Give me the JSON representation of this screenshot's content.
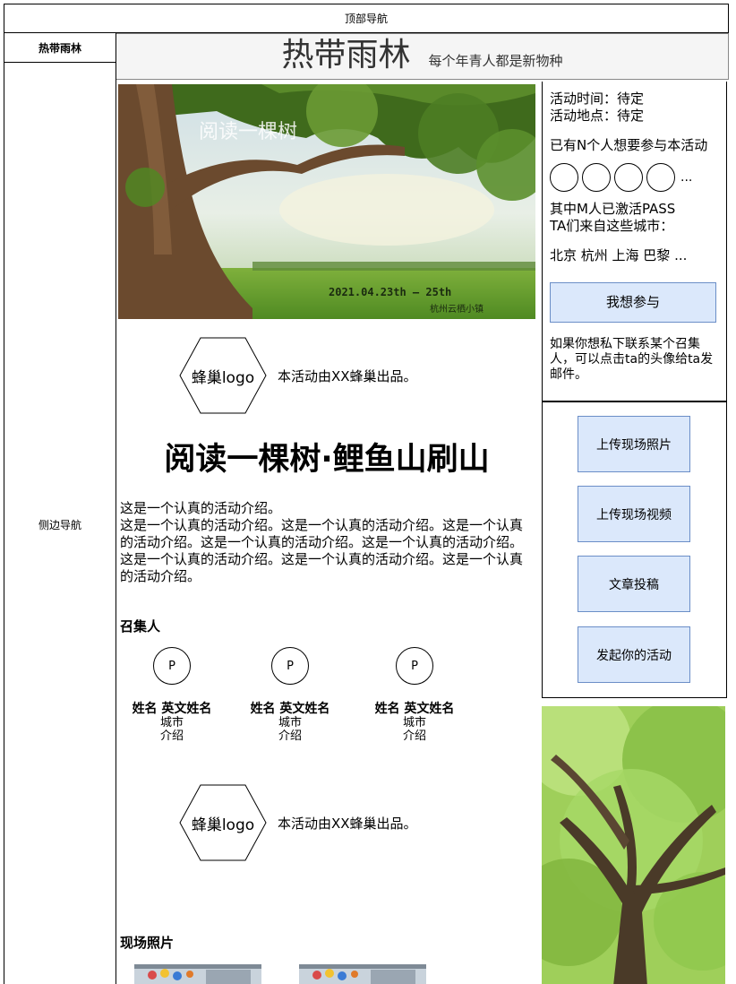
{
  "top_nav": {
    "label": "顶部导航"
  },
  "side_nav": {
    "brand": "热带雨林",
    "label": "侧边导航"
  },
  "header": {
    "title": "热带雨林",
    "subtitle": "每个年青人都是新物种"
  },
  "poster": {
    "title": "阅读一棵树",
    "dates": "2021.04.23th — 25th",
    "place": "杭州云栖小镇"
  },
  "event_info": {
    "time": "活动时间：待定",
    "location": "活动地点：待定",
    "interested": "已有N个人想要参与本活动",
    "more_avatars": "...",
    "pass_count": "其中M人已激活PASS",
    "cities_label": "TA们来自这些城市：",
    "cities": "北京 杭州 上海 巴黎 ...",
    "join_button": "我想参与",
    "private_note": "如果你想私下联系某个召集人，可以点击ta的头像给ta发邮件。"
  },
  "actions": {
    "upload_photos": "上传现场照片",
    "upload_video": "上传现场视频",
    "submit_article": "文章投稿",
    "start_event": "发起你的活动"
  },
  "organizer_block": {
    "logo": "蜂巢logo",
    "text": "本活动由XX蜂巢出品。"
  },
  "event": {
    "title": "阅读一棵树·鲤鱼山刷山",
    "intro_line1": "这是一个认真的活动介绍。",
    "intro_body": "这是一个认真的活动介绍。这是一个认真的活动介绍。这是一个认真的活动介绍。这是一个认真的活动介绍。这是一个认真的活动介绍。这是一个认真的活动介绍。这是一个认真的活动介绍。这是一个认真的活动介绍。"
  },
  "organizers": {
    "title": "召集人",
    "people": [
      {
        "avatar": "P",
        "name": "姓名 英文姓名",
        "city": "城市",
        "bio": "介绍"
      },
      {
        "avatar": "P",
        "name": "姓名 英文姓名",
        "city": "城市",
        "bio": "介绍"
      },
      {
        "avatar": "P",
        "name": "姓名 英文姓名",
        "city": "城市",
        "bio": "介绍"
      }
    ]
  },
  "photos": {
    "title": "现场照片"
  },
  "colors": {
    "button_fill": "#dbe8fb",
    "button_border": "#6b8ec7",
    "header_bg": "#f5f5f5"
  }
}
